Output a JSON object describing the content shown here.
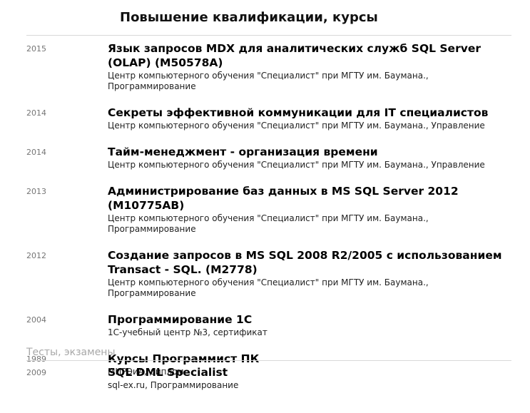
{
  "courses": {
    "heading": "Повышение квалификации, курсы",
    "items": [
      {
        "year": "2015",
        "title": "Язык запросов MDX для аналитических служб SQL Server (OLAP) (M50578A)",
        "meta": "Центр компьютерного обучения \"Специалист\" при МГТУ им. Баумана., Программирование"
      },
      {
        "year": "2014",
        "title": "Секреты эффективной коммуникации для IT специалистов",
        "meta": "Центр компьютерного обучения \"Специалист\" при МГТУ им. Баумана., Управление"
      },
      {
        "year": "2014",
        "title": "Тайм-менеджмент - организация времени",
        "meta": "Центр компьютерного обучения \"Специалист\" при МГТУ им. Баумана., Управление"
      },
      {
        "year": "2013",
        "title": "Администрирование баз данных в MS SQL Server 2012 (M10775AB)",
        "meta": "Центр компьютерного обучения \"Специалист\" при МГТУ им. Баумана., Программирование"
      },
      {
        "year": "2012",
        "title": "Создание запросов в MS SQL 2008 R2/2005 с использованием Transact - SQL. (M2778)",
        "meta": "Центр компьютерного обучения \"Специалист\" при МГТУ им. Баумана., Программирование"
      },
      {
        "year": "2004",
        "title": "Программирование 1С",
        "meta": "1С-учебный центр №3, сертификат"
      },
      {
        "year": "1989",
        "title": "Курсы Программист ПК",
        "meta": "МИРЭиА, диплом"
      }
    ]
  },
  "tests": {
    "heading": "Тесты, экзамены",
    "items": [
      {
        "year": "2009",
        "title": "SQL DML Specialist",
        "meta": "sql-ex.ru, Программирование"
      }
    ]
  }
}
